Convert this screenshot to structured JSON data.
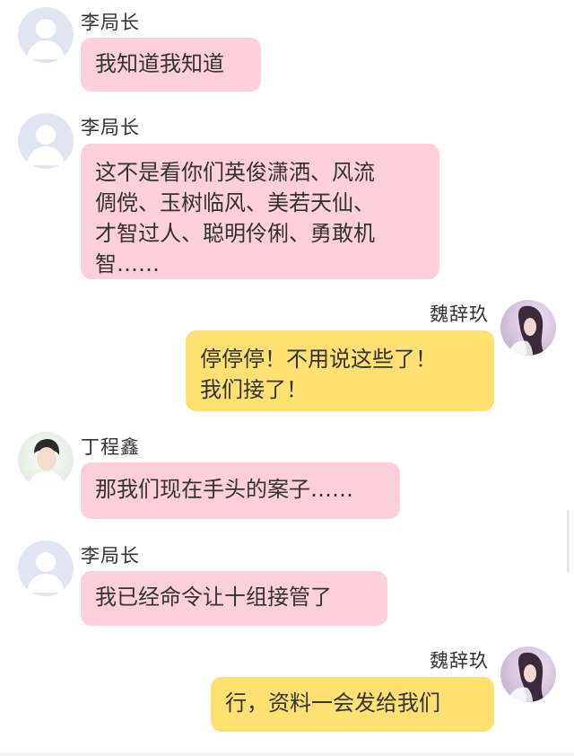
{
  "messages": [
    {
      "sender": "李局长",
      "side": "left",
      "avatar": "default-avatar-icon",
      "lines": [
        "我知道我知道"
      ]
    },
    {
      "sender": "李局长",
      "side": "left",
      "avatar": "default-avatar-icon",
      "lines": [
        "这不是看你们英俊潇洒、风流",
        "倜傥、玉树临风、美若天仙、",
        "才智过人、聪明伶俐、勇敢机",
        "智……"
      ]
    },
    {
      "sender": "魏辞玖",
      "side": "right",
      "avatar": "user-photo-avatar",
      "lines": [
        "停停停！不用说这些了！",
        "我们接了！"
      ]
    },
    {
      "sender": "丁程鑫",
      "side": "left",
      "avatar": "user-photo-avatar",
      "lines": [
        "那我们现在手头的案子……"
      ]
    },
    {
      "sender": "李局长",
      "side": "left",
      "avatar": "default-avatar-icon",
      "lines": [
        "我已经命令让十组接管了"
      ]
    },
    {
      "sender": "魏辞玖",
      "side": "right",
      "avatar": "user-photo-avatar",
      "lines": [
        "行，资料一会发给我们"
      ]
    }
  ],
  "colors": {
    "left_bubble": "#ffd0dc",
    "right_bubble": "#ffe070",
    "default_avatar_bg": "#dfe6f1"
  }
}
